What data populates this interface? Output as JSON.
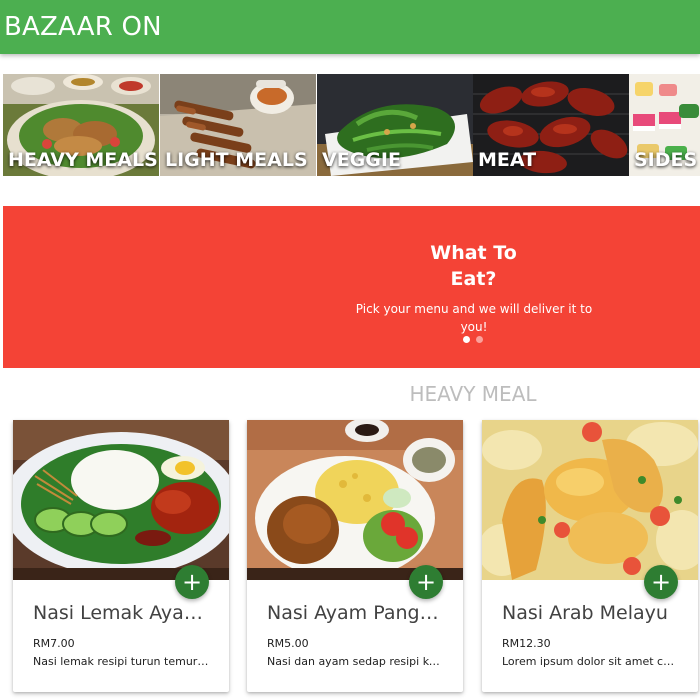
{
  "app": {
    "title": "BAZAAR ON"
  },
  "categories": [
    {
      "label": "HEAVY MEALS"
    },
    {
      "label": "LIGHT MEALS"
    },
    {
      "label": "VEGGIE"
    },
    {
      "label": "MEAT"
    },
    {
      "label": "SIDES"
    }
  ],
  "hero": {
    "title": "What To Eat?",
    "subtitle": "Pick your menu and we will deliver it to you!",
    "slides": 2,
    "active_slide": 1
  },
  "section": {
    "title": "HEAVY MEAL"
  },
  "products": [
    {
      "name": "Nasi Lemak Ayam Goreng",
      "price": "RM7.00",
      "description": "Nasi lemak resipi turun temurun",
      "add_icon": "+"
    },
    {
      "name": "Nasi Ayam Panggang",
      "price": "RM5.00",
      "description": "Nasi dan ayam sedap resipi keluarga",
      "add_icon": "+"
    },
    {
      "name": "Nasi Arab Melayu",
      "price": "RM12.30",
      "description": "Lorem ipsum dolor sit amet consectetur",
      "add_icon": "+"
    }
  ],
  "colors": {
    "appbar": "#4caf50",
    "hero": "#f44336",
    "fab": "#2e7d32",
    "section_title": "#bdbdbd"
  },
  "icons": {
    "add": "add-icon"
  }
}
